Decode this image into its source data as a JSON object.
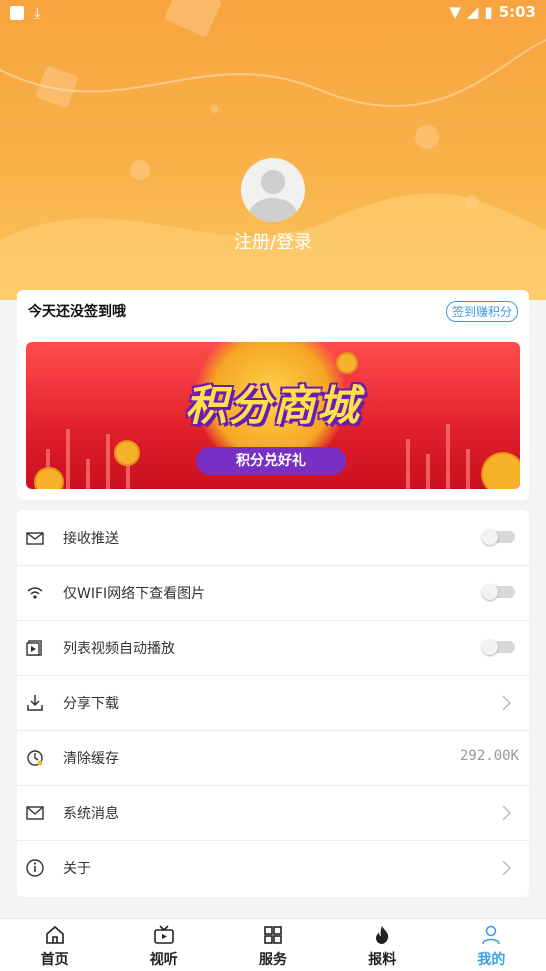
{
  "status_bar": {
    "time": "5:03"
  },
  "header": {
    "login_text": "注册/登录"
  },
  "sign_card": {
    "title": "今天还没签到哦",
    "badge": "签到赚积分",
    "banner": {
      "title": "积分商城",
      "subtitle": "积分兑好礼"
    }
  },
  "settings": [
    {
      "label": "接收推送",
      "icon": "envelope-tray-icon",
      "control": "toggle",
      "on": false
    },
    {
      "label": "仅WIFI网络下查看图片",
      "icon": "wifi-icon",
      "control": "toggle",
      "on": false
    },
    {
      "label": "列表视频自动播放",
      "icon": "video-play-icon",
      "control": "toggle",
      "on": false
    },
    {
      "label": "分享下载",
      "icon": "download-icon",
      "control": "chevron"
    },
    {
      "label": "清除缓存",
      "icon": "clear-cache-icon",
      "control": "value",
      "value": "292.00K"
    },
    {
      "label": "系统消息",
      "icon": "mail-icon",
      "control": "chevron"
    },
    {
      "label": "关于",
      "icon": "info-icon",
      "control": "chevron"
    }
  ],
  "bottom_nav": [
    {
      "label": "首页",
      "icon": "home-icon",
      "active": false
    },
    {
      "label": "视听",
      "icon": "tv-icon",
      "active": false
    },
    {
      "label": "服务",
      "icon": "grid-icon",
      "active": false
    },
    {
      "label": "报料",
      "icon": "flame-icon",
      "active": false
    },
    {
      "label": "我的",
      "icon": "user-icon",
      "active": true
    }
  ],
  "colors": {
    "header": "#f9b24a",
    "accent": "#3aa0ea",
    "banner": "#e01f2c"
  }
}
